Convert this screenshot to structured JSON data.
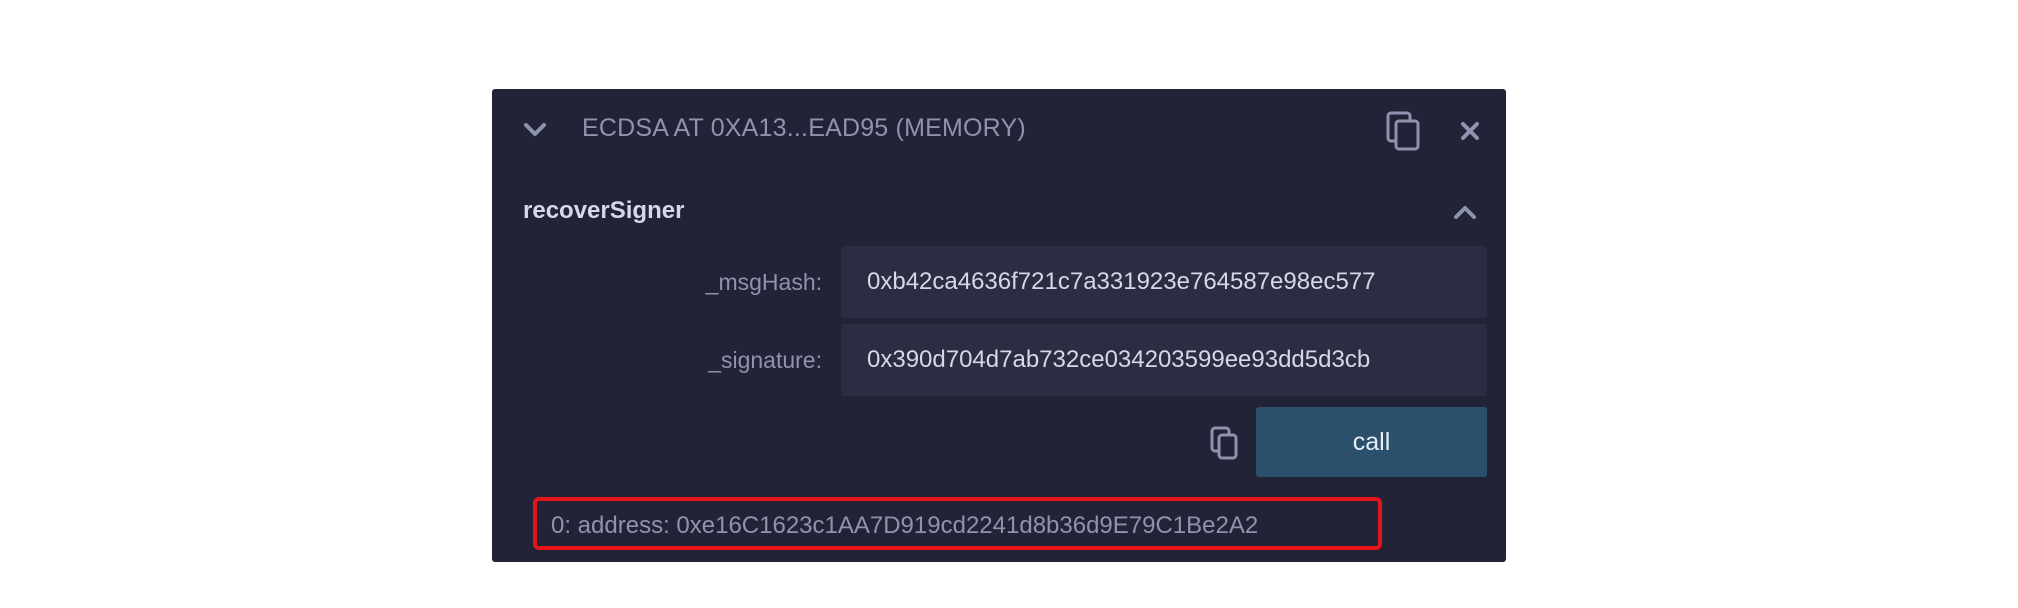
{
  "contract": {
    "title": "ECDSA AT 0XA13...EAD95 (MEMORY)",
    "icons": {
      "collapse": "chevron-down-icon",
      "copy": "copy-icon",
      "close": "close-icon"
    }
  },
  "function": {
    "name": "recoverSigner",
    "expand_icon": "chevron-up-icon",
    "params": [
      {
        "label": "_msgHash:",
        "value": "0xb42ca4636f721c7a331923e764587e98ec577"
      },
      {
        "label": "_signature:",
        "value": "0x390d704d7ab732ce034203599ee93dd5d3cb"
      }
    ],
    "call_label": "call"
  },
  "result": {
    "text": "0: address: 0xe16C1623c1AA7D919cd2241d8b36d9E79C1Be2A2",
    "highlight_color": "#e5141a"
  },
  "colors": {
    "panel_bg": "#222336",
    "input_bg": "#2b2d42",
    "button_bg": "#2b506b",
    "muted_text": "#8e94ad"
  }
}
